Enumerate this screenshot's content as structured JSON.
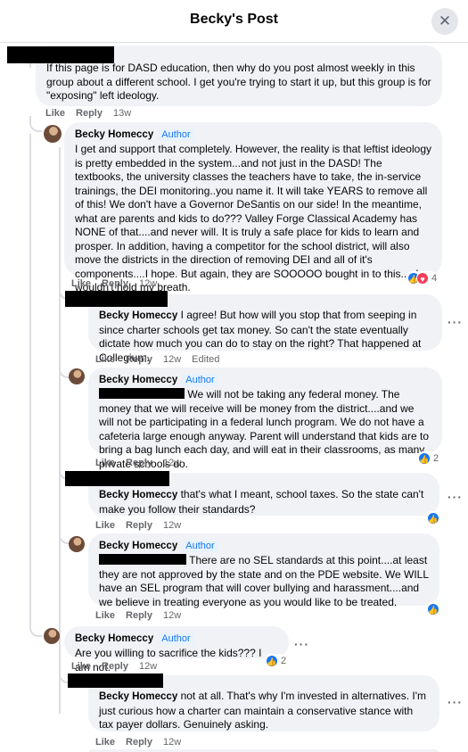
{
  "header": {
    "title": "Becky's Post",
    "close_icon": "✕"
  },
  "badge_author": "Author",
  "actions": {
    "like": "Like",
    "reply": "Reply",
    "edited": "Edited"
  },
  "more_icon": "···",
  "comments": [
    {
      "text": "If this page is for DASD education, then why do you post almost weekly in this group about a different school. I get you're trying to start it up, but this group is for \"exposing\" left ideology.",
      "time": "13w"
    },
    {
      "author": "Becky Homeccy",
      "text": "I get and support that completely. However, the reality is that leftist ideology is pretty embedded in the system...and not just in the DASD! The textbooks, the university classes the teachers have to take, the in-service trainings, the DEI monitoring..you name it. It will take YEARS to remove all of this! We don't have a Governor DeSantis on our side! In the meantime, what are parents and kids to do??? Valley Forge Classical Academy has NONE of that....and never will. It is truly a safe place for kids to learn and prosper. In addition, having a competitor for the school district, will also move the districts in the direction of removing DEI and all of it's components....I hope. But again, they are SOOOOO bought in to this.....I wouldn't hold my breath.",
      "time": "12w",
      "reactions": "4"
    },
    {
      "mention": "Becky Homeccy",
      "text": "I agree! But how will you stop that from seeping in since charter schools get tax money. So can't the state eventually dictate how much you can do to stay on the right? That happened at Collegium.",
      "time": "12w"
    },
    {
      "author": "Becky Homeccy",
      "text": "We will not be taking any federal money. The money that we will receive will be money from the district....and we will not be participating in a federal lunch program. We do not have a cafeteria large enough anyway. Parent will understand that kids are to bring a bag lunch each day, and will eat in their classrooms, as many private schools do.",
      "time": "12w",
      "reactions": "2"
    },
    {
      "mention": "Becky Homeccy",
      "text": "that's what I meant, school taxes. So the state can't make you follow their standards?",
      "time": "12w"
    },
    {
      "author": "Becky Homeccy",
      "text": "There are no SEL standards at this point....at least they are not approved by the state and on the PDE website. We WILL have an SEL program that will cover bullying and harassment....and we believe in treating everyone as you would like to be treated.",
      "time": "12w"
    },
    {
      "author": "Becky Homeccy",
      "text": "Are you willing to sacrifice the kids??? I am not.",
      "time": "12w",
      "reactions": "2"
    },
    {
      "mention": "Becky Homeccy",
      "text": "not at all. That's why I'm invested in alternatives. I'm just curious how a charter can maintain a conservative stance with tax payer dollars. Genuinely asking.",
      "time": "12w"
    }
  ]
}
